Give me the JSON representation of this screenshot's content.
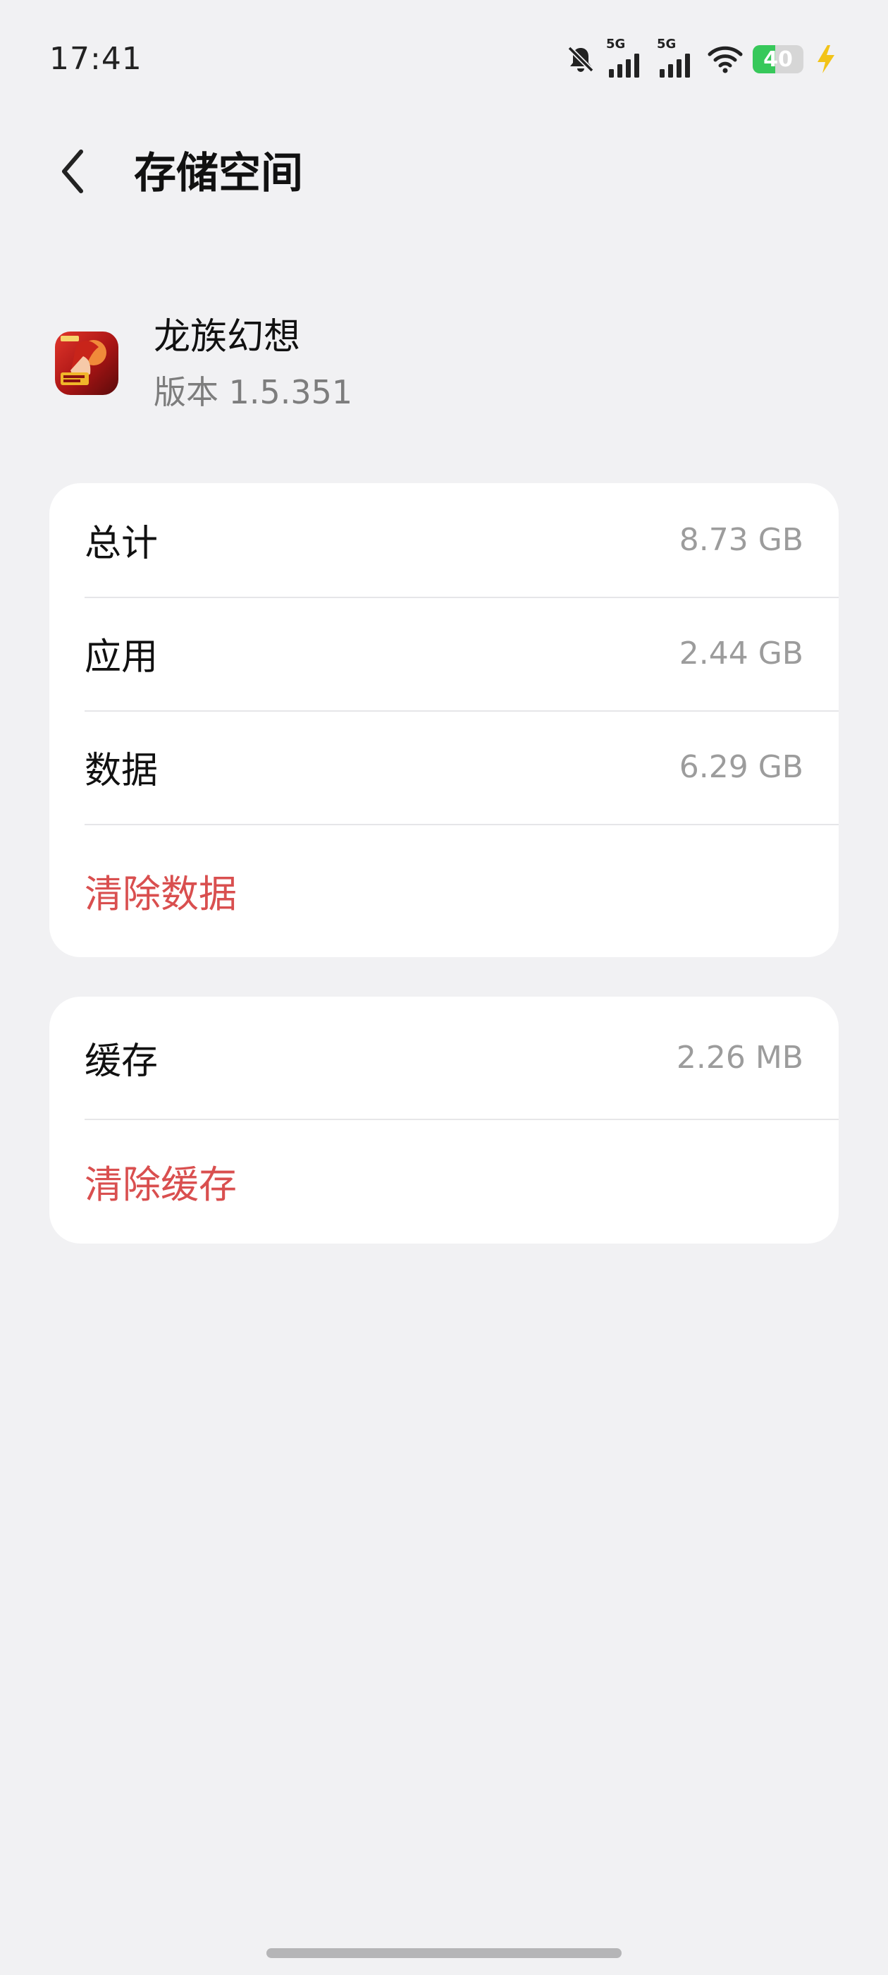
{
  "status_bar": {
    "time": "17:41",
    "network_1": "5G",
    "network_2": "5G",
    "battery_level": "40",
    "battery_fraction": 0.45,
    "icons": [
      "bell-off-icon",
      "signal-icon",
      "signal-icon",
      "wifi-icon",
      "battery-icon",
      "charging-bolt-icon"
    ],
    "colors": {
      "battery_fill": "#37c85a",
      "charging": "#f2c318"
    }
  },
  "header": {
    "back_icon": "chevron-left-icon",
    "title": "存储空间"
  },
  "app": {
    "name": "龙族幻想",
    "version": "版本 1.5.351",
    "icon": "app-icon-game"
  },
  "storage": {
    "rows": [
      {
        "label": "总计",
        "value": "8.73 GB"
      },
      {
        "label": "应用",
        "value": "2.44 GB"
      },
      {
        "label": "数据",
        "value": "6.29 GB"
      }
    ],
    "clear_data": "清除数据"
  },
  "cache": {
    "label": "缓存",
    "value": "2.26 MB",
    "clear_cache": "清除缓存"
  },
  "colors": {
    "background": "#f1f1f3",
    "card": "#ffffff",
    "action_red": "#d94f4f",
    "value_gray": "#9c9c9c"
  }
}
